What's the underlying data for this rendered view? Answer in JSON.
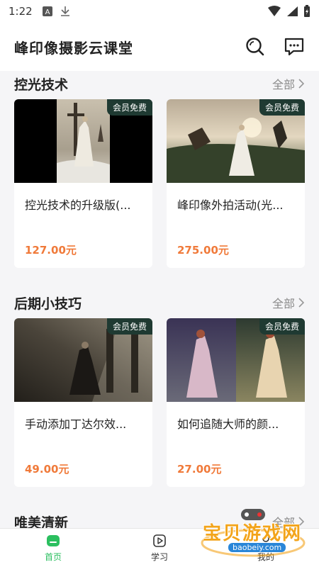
{
  "status": {
    "time": "1:22"
  },
  "app": {
    "title": "峰印像摄影云课堂"
  },
  "sections": [
    {
      "title": "控光技术",
      "all_label": "全部",
      "cards": [
        {
          "badge": "会员免费",
          "title": "控光技术的升级版(...",
          "price": "127.00元"
        },
        {
          "badge": "会员免费",
          "title": "峰印像外拍活动(光...",
          "price": "275.00元"
        }
      ]
    },
    {
      "title": "后期小技巧",
      "all_label": "全部",
      "cards": [
        {
          "badge": "会员免费",
          "title": "手动添加丁达尔效...",
          "price": "49.00元"
        },
        {
          "badge": "会员免费",
          "title": "如何追随大师的颜...",
          "price": "27.00元"
        }
      ]
    },
    {
      "title": "唯美清新",
      "all_label": "全部",
      "cards": []
    }
  ],
  "tabs": [
    {
      "label": "首页",
      "icon": "home-icon",
      "active": true
    },
    {
      "label": "学习",
      "icon": "play-icon",
      "active": false
    },
    {
      "label": "我的",
      "icon": "user-icon",
      "active": false
    }
  ],
  "watermark": {
    "text": "宝贝游戏网",
    "url": "baobeiy.com"
  },
  "colors": {
    "accent": "#2bbf5f",
    "price": "#f07a3a",
    "badge_bg": "#1f3a32"
  }
}
